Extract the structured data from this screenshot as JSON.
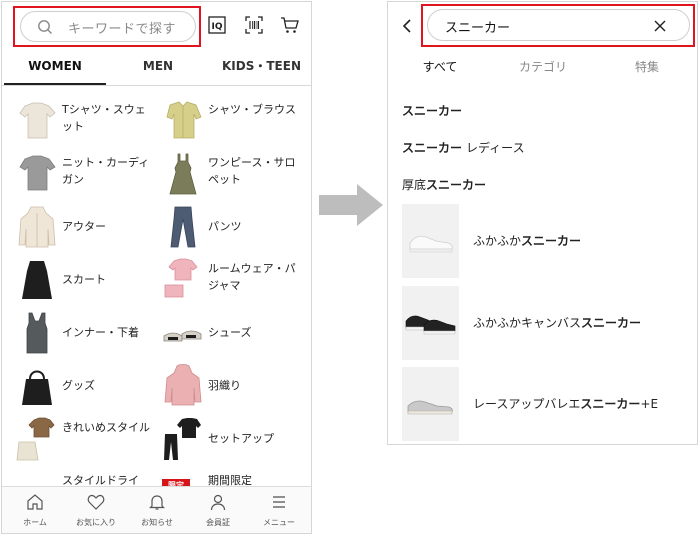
{
  "left": {
    "search_placeholder": "キーワードで探す",
    "tabs": [
      "WOMEN",
      "MEN",
      "KIDS・TEEN"
    ],
    "categories": [
      {
        "label": "Tシャツ・スウェット",
        "thumb": "tshirt-icon"
      },
      {
        "label": "シャツ・ブラウス",
        "thumb": "blouse-icon"
      },
      {
        "label": "ニット・カーディガン",
        "thumb": "knit-icon"
      },
      {
        "label": "ワンピース・サロペット",
        "thumb": "dress-icon"
      },
      {
        "label": "アウター",
        "thumb": "outer-icon"
      },
      {
        "label": "パンツ",
        "thumb": "pants-icon"
      },
      {
        "label": "スカート",
        "thumb": "skirt-icon"
      },
      {
        "label": "ルームウェア・パジャマ",
        "thumb": "pajama-icon"
      },
      {
        "label": "インナー・下着",
        "thumb": "inner-icon"
      },
      {
        "label": "シューズ",
        "thumb": "shoes-icon"
      },
      {
        "label": "グッズ",
        "thumb": "bag-icon"
      },
      {
        "label": "羽織り",
        "thumb": "hoodie-icon"
      },
      {
        "label": "きれいめスタイル",
        "thumb": "style-icon"
      },
      {
        "label": "セットアップ",
        "thumb": "setup-icon"
      },
      {
        "label": "スタイルドライ",
        "thumb": ""
      },
      {
        "label": "期間限定",
        "badge": "限定"
      }
    ],
    "bottom_nav": [
      "ホーム",
      "お気に入り",
      "お知らせ",
      "会員証",
      "メニュー"
    ]
  },
  "right": {
    "search_value": "スニーカー",
    "tabs": [
      "すべて",
      "カテゴリ",
      "特集"
    ],
    "suggestions": [
      {
        "bold": "スニーカー",
        "rest": ""
      },
      {
        "bold": "スニーカー",
        "rest": "レディース"
      },
      {
        "pre": "厚底",
        "bold": "スニーカー",
        "rest": ""
      }
    ],
    "products": [
      {
        "pre": "ふかふか",
        "bold": "スニーカー",
        "post": ""
      },
      {
        "pre": "ふかふかキャンバス",
        "bold": "スニーカー",
        "post": ""
      },
      {
        "pre": "レースアップバレエ",
        "bold": "スニーカー",
        "post": "+E"
      }
    ]
  },
  "colors": {
    "highlight_red": "#e0141e",
    "badge_red": "#d7141a",
    "arrow_gray": "#bdbdbd"
  }
}
